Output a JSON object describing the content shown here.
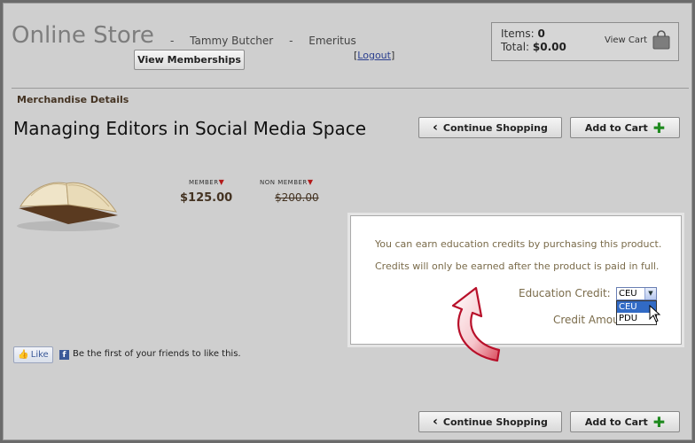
{
  "header": {
    "store_title": "Online Store",
    "separator": "-",
    "user_name": "Tammy Butcher",
    "member_type": "Emeritus",
    "view_memberships": "View Memberships",
    "logout_label": "Logout"
  },
  "cart": {
    "items_label": "Items:",
    "items_count": "0",
    "total_label": "Total:",
    "total_value": "$0.00",
    "view_cart": "View Cart"
  },
  "main": {
    "section_label": "Merchandise Details",
    "product_title": "Managing Editors in Social Media Space",
    "continue_shopping": "Continue Shopping",
    "add_to_cart": "Add to Cart",
    "member_label": "MEMBER",
    "nonmember_label": "NON MEMBER",
    "member_price": "$125.00",
    "nonmember_price": "$200.00"
  },
  "credits": {
    "line1": "You can earn education credits by purchasing this product.",
    "line2": "Credits will only be earned after the product is paid in full.",
    "education_credit_label": "Education Credit:",
    "selected": "CEU",
    "options": [
      "CEU",
      "PDU"
    ],
    "credit_amount_label": "Credit Amount: 1.5"
  },
  "social": {
    "like_label": "Like",
    "like_text": "Be the first of your friends to like this."
  },
  "colors": {
    "accent_green": "#1f8a1f",
    "facebook_blue": "#3b5998",
    "highlight": "#316ac5"
  },
  "icons": [
    "chevron-left-icon",
    "plus-icon",
    "shopping-bag-icon",
    "thumbs-up-icon",
    "facebook-icon",
    "cursor-icon",
    "curved-arrow-icon",
    "book-icon"
  ]
}
